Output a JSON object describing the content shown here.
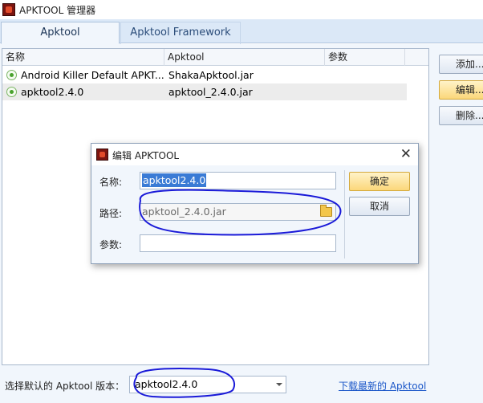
{
  "window": {
    "title": "APKTOOL 管理器",
    "icon": "app-icon"
  },
  "tabs": [
    {
      "label": "Apktool",
      "active": true
    },
    {
      "label": "Apktool Framework",
      "active": false
    }
  ],
  "list": {
    "columns": [
      "名称",
      "Apktool",
      "参数"
    ],
    "rows": [
      {
        "name": "Android Killer Default APKT...",
        "apktool": "ShakaApktool.jar",
        "params": "",
        "selected": false
      },
      {
        "name": "apktool2.4.0",
        "apktool": "apktool_2.4.0.jar",
        "params": "",
        "selected": true
      }
    ]
  },
  "side_buttons": {
    "add": "添加...",
    "edit": "编辑...",
    "delete": "删除..."
  },
  "bottom": {
    "label": "选择默认的 Apktool 版本：",
    "selected_version": "apktool2.4.0",
    "download_link": "下载最新的 Apktool"
  },
  "dialog": {
    "title": "编辑 APKTOOL",
    "name_label": "名称:",
    "name_value": "apktool2.4.0",
    "path_label": "路径:",
    "path_value": "apktool_2.4.0.jar",
    "params_label": "参数:",
    "params_value": "",
    "ok_label": "确定",
    "cancel_label": "取消"
  },
  "colors": {
    "accent_yellow": "#fbd77a",
    "tab_bar": "#dbe8f7",
    "annotation_blue": "#1a1ad8",
    "link": "#1a56c8"
  }
}
